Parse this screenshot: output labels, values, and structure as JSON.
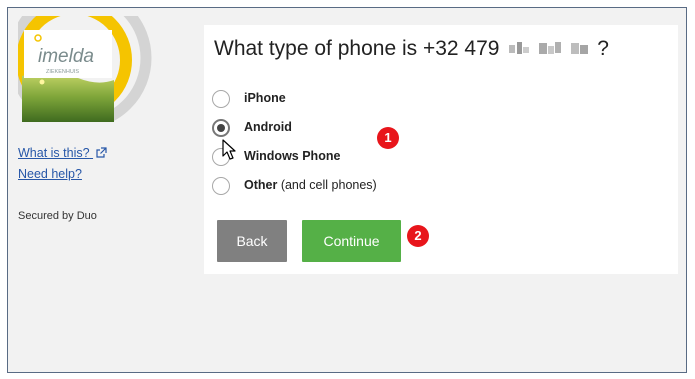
{
  "sidebar": {
    "logo_text": "imelda",
    "logo_subtext": "ZIEKENHUIS",
    "what_is_this": "What is this?",
    "need_help": "Need help?",
    "secured_by": "Secured by Duo"
  },
  "prompt": {
    "question_prefix": "What type of phone is +32 479",
    "question_suffix": "?"
  },
  "options": [
    {
      "label": "iPhone",
      "sub": "",
      "checked": false
    },
    {
      "label": "Android",
      "sub": "",
      "checked": true
    },
    {
      "label": "Windows Phone",
      "sub": "",
      "checked": false
    },
    {
      "label": "Other",
      "sub": " (and cell phones)",
      "checked": false
    }
  ],
  "buttons": {
    "back": "Back",
    "continue": "Continue"
  },
  "annotations": {
    "step1": "1",
    "step2": "2"
  },
  "colors": {
    "continue": "#55b047",
    "back": "#808080",
    "badge": "#e8151b",
    "link": "#2757a8"
  }
}
